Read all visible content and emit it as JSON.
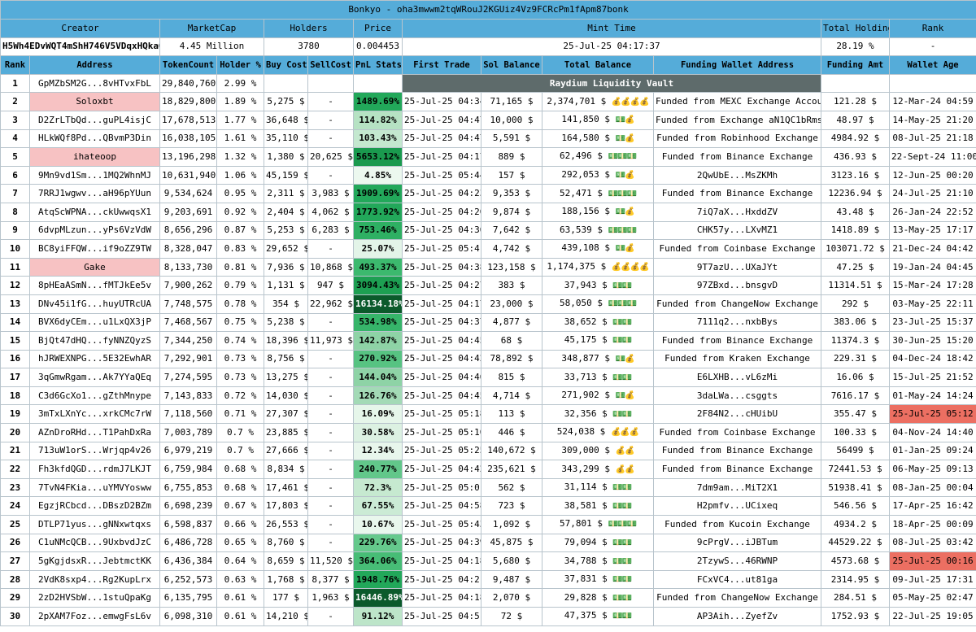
{
  "title": "Bonkyo - oha3mwwm2tqWRouJ2KGUiz4Vz9FCRcPm1fApm87bonk",
  "summary_headers": {
    "creator": "Creator",
    "marketcap": "MarketCap",
    "holders": "Holders",
    "price": "Price",
    "mint_time": "Mint Time",
    "total_holding": "Total Holding",
    "rank": "Rank"
  },
  "summary_values": {
    "creator": "H5Wh4EDvWQT4mShH746V5VDqxHQkaQZyPWfuhy1PRVBg",
    "marketcap": "4.45 Million",
    "holders": "3780",
    "price": "0.004453",
    "mint_time": "25-Jul-25 04:17:37",
    "total_holding": "28.19 %",
    "rank": "-"
  },
  "columns": [
    "Rank",
    "Address",
    "TokenCount",
    "Holder %",
    "Buy Cost",
    "SellCost",
    "PnL Stats",
    "First Trade",
    "Sol Balance",
    "Total Balance",
    "Funding Wallet Address",
    "Funding Amt",
    "Wallet Age"
  ],
  "vault_label": "Raydium Liquidity Vault",
  "rows": [
    {
      "rank": "1",
      "address": "GpMZbSM2G...8vHTvxFbL",
      "tokens": "29,840,760",
      "holder": "2.99 %",
      "vault": true
    },
    {
      "rank": "2",
      "address": "Soloxbt",
      "tokens": "18,829,800",
      "holder": "1.89 %",
      "buy": "5,275 $",
      "sell": "-",
      "pnl": "1489.69%",
      "pnl_color": "#22a85a",
      "first": "25-Jul-25 04:34",
      "sol": "71,165 $",
      "total": "2,374,701 $",
      "icons": "💰💰💰💰",
      "icon_style": "blue",
      "funding": "Funded from MEXC Exchange Account",
      "amt": "121.28 $",
      "age": "12-Mar-24 04:59",
      "highlight": "pink"
    },
    {
      "rank": "3",
      "address": "D2ZrLTbQd...guPL4isjC",
      "tokens": "17,678,513",
      "holder": "1.77 %",
      "buy": "36,648 $",
      "sell": "-",
      "pnl": "114.82%",
      "pnl_color": "#b6e2c3",
      "first": "25-Jul-25 04:47",
      "sol": "10,000 $",
      "total": "141,850 $",
      "icons": "💵💰",
      "icon_style": "grey",
      "funding": "Funded from Exchange aN1QC1bRmsR",
      "amt": "48.97 $",
      "age": "14-May-25 21:20"
    },
    {
      "rank": "4",
      "address": "HLkWQf8Pd...QBvmP3Din",
      "tokens": "16,038,105",
      "holder": "1.61 %",
      "buy": "35,110 $",
      "sell": "-",
      "pnl": "103.43%",
      "pnl_color": "#c4e8cf",
      "first": "25-Jul-25 04:47",
      "sol": "5,591 $",
      "total": "164,580 $",
      "icons": "💵💰",
      "icon_style": "grey",
      "funding": "Funded from Robinhood Exchange",
      "amt": "4984.92 $",
      "age": "08-Jul-25 21:18"
    },
    {
      "rank": "5",
      "address": "ihateoop",
      "tokens": "13,196,298",
      "holder": "1.32 %",
      "buy": "1,380 $",
      "sell": "20,625 $",
      "pnl": "5653.12%",
      "pnl_color": "#1a9a4e",
      "first": "25-Jul-25 04:17",
      "sol": "889 $",
      "total": "62,496 $",
      "icons": "💵💵💵",
      "icon_style": "grey",
      "funding": "Funded from Binance Exchange",
      "amt": "436.93 $",
      "age": "22-Sept-24 11:00",
      "highlight": "pink"
    },
    {
      "rank": "6",
      "address": "9Mn9vd1Sm...1MQ2WhnMJ",
      "tokens": "10,631,940",
      "holder": "1.06 %",
      "buy": "45,159 $",
      "sell": "-",
      "pnl": "4.85%",
      "pnl_color": "#ecf8ef",
      "first": "25-Jul-25 05:44",
      "sol": "157 $",
      "total": "292,053 $",
      "icons": "💵💰",
      "icon_style": "grey",
      "funding": "2QwUbE...MsZKMh",
      "amt": "3123.16 $",
      "age": "12-Jun-25 00:20"
    },
    {
      "rank": "7",
      "address": "7RRJ1wgwv...aH96pYUun",
      "tokens": "9,534,624",
      "holder": "0.95 %",
      "buy": "2,311 $",
      "sell": "3,983 $",
      "pnl": "1909.69%",
      "pnl_color": "#22a85a",
      "first": "25-Jul-25 04:23",
      "sol": "9,353 $",
      "total": "52,471 $",
      "icons": "💵💵💵",
      "icon_style": "grey",
      "funding": "Funded from Binance Exchange",
      "amt": "12236.94 $",
      "age": "24-Jul-25 21:10"
    },
    {
      "rank": "8",
      "address": "AtqScWPNA...ckUwwqsX1",
      "tokens": "9,203,691",
      "holder": "0.92 %",
      "buy": "2,404 $",
      "sell": "4,062 $",
      "pnl": "1773.92%",
      "pnl_color": "#22a85a",
      "first": "25-Jul-25 04:20",
      "sol": "9,874 $",
      "total": "188,156 $",
      "icons": "💵💰",
      "icon_style": "grey",
      "funding": "7iQ7aX...HxddZV",
      "amt": "43.48 $",
      "age": "26-Jan-24 22:52"
    },
    {
      "rank": "9",
      "address": "6dvpMLzun...yPs6VzVdW",
      "tokens": "8,656,296",
      "holder": "0.87 %",
      "buy": "5,253 $",
      "sell": "6,283 $",
      "pnl": "753.46%",
      "pnl_color": "#2eb063",
      "first": "25-Jul-25 04:36",
      "sol": "7,642 $",
      "total": "63,539 $",
      "icons": "💵💵💵",
      "icon_style": "grey",
      "funding": "CHK57y...LXvMZ1",
      "amt": "1418.89 $",
      "age": "13-May-25 17:17"
    },
    {
      "rank": "10",
      "address": "BC8yiFFQW...if9oZZ9TW",
      "tokens": "8,328,047",
      "holder": "0.83 %",
      "buy": "29,652 $",
      "sell": "-",
      "pnl": "25.07%",
      "pnl_color": "#e3f4e8",
      "first": "25-Jul-25 05:41",
      "sol": "4,742 $",
      "total": "439,108 $",
      "icons": "💵💰",
      "icon_style": "grey",
      "funding": "Funded from Coinbase Exchange",
      "amt": "103071.72 $",
      "age": "21-Dec-24 04:42"
    },
    {
      "rank": "11",
      "address": "Gake",
      "tokens": "8,133,730",
      "holder": "0.81 %",
      "buy": "7,936 $",
      "sell": "10,868 $",
      "pnl": "493.37%",
      "pnl_color": "#3cb96e",
      "first": "25-Jul-25 04:38",
      "sol": "123,158 $",
      "total": "1,174,375 $",
      "icons": "💰💰💰💰",
      "icon_style": "blue",
      "funding": "9T7azU...UXaJYt",
      "amt": "47.25 $",
      "age": "19-Jan-24 04:45",
      "highlight": "pink"
    },
    {
      "rank": "12",
      "address": "8pHEaASmN...fMTJkEe5v",
      "tokens": "7,900,262",
      "holder": "0.79 %",
      "buy": "1,131 $",
      "sell": "947 $",
      "pnl": "3094.43%",
      "pnl_color": "#1d9f52",
      "first": "25-Jul-25 04:27",
      "sol": "383 $",
      "total": "37,943 $",
      "icons": "💵💵",
      "icon_style": "grey",
      "funding": "97ZBxd...bnsgvD",
      "amt": "11314.51 $",
      "age": "15-Mar-24 17:28"
    },
    {
      "rank": "13",
      "address": "DNv45i1fG...huyUTRcUA",
      "tokens": "7,748,575",
      "holder": "0.78 %",
      "buy": "354 $",
      "sell": "22,962 $",
      "pnl": "16134.18%",
      "pnl_color": "#0b5a2b",
      "pnl_text": "#ffffff",
      "first": "25-Jul-25 04:17",
      "sol": "23,000 $",
      "total": "58,050 $",
      "icons": "💵💵💵",
      "icon_style": "grey",
      "funding": "Funded from ChangeNow Exchange",
      "amt": "292 $",
      "age": "03-May-25 22:11"
    },
    {
      "rank": "14",
      "address": "BVX6dyCEm...u1LxQX3jP",
      "tokens": "7,468,567",
      "holder": "0.75 %",
      "buy": "5,238 $",
      "sell": "-",
      "pnl": "534.98%",
      "pnl_color": "#36b56a",
      "first": "25-Jul-25 04:37",
      "sol": "4,877 $",
      "total": "38,652 $",
      "icons": "💵💵",
      "icon_style": "grey",
      "funding": "7111q2...nxbBys",
      "amt": "383.06 $",
      "age": "23-Jul-25 15:37"
    },
    {
      "rank": "15",
      "address": "BjQt47dHQ...fyNNZQyzS",
      "tokens": "7,344,250",
      "holder": "0.74 %",
      "buy": "18,396 $",
      "sell": "11,973 $",
      "pnl": "142.87%",
      "pnl_color": "#8ed3a6",
      "first": "25-Jul-25 04:45",
      "sol": "68 $",
      "total": "45,175 $",
      "icons": "💵💵",
      "icon_style": "grey",
      "funding": "Funded from Binance Exchange",
      "amt": "11374.3 $",
      "age": "30-Jun-25 15:20"
    },
    {
      "rank": "16",
      "address": "hJRWEXNPG...5E32EwhAR",
      "tokens": "7,292,901",
      "holder": "0.73 %",
      "buy": "8,756 $",
      "sell": "-",
      "pnl": "270.92%",
      "pnl_color": "#57c382",
      "first": "25-Jul-25 04:42",
      "sol": "78,892 $",
      "total": "348,877 $",
      "icons": "💵💰",
      "icon_style": "grey",
      "funding": "Funded from Kraken Exchange",
      "amt": "229.31 $",
      "age": "04-Dec-24 18:42"
    },
    {
      "rank": "17",
      "address": "3qGmwRgam...Ak7YYaQEq",
      "tokens": "7,274,595",
      "holder": "0.73 %",
      "buy": "13,275 $",
      "sell": "-",
      "pnl": "144.04%",
      "pnl_color": "#8ed3a6",
      "first": "25-Jul-25 04:46",
      "sol": "815 $",
      "total": "33,713 $",
      "icons": "💵💵",
      "icon_style": "grey",
      "funding": "E6LXHB...vL6zMi",
      "amt": "16.06 $",
      "age": "15-Jul-25 21:52"
    },
    {
      "rank": "18",
      "address": "C3d6GcXo1...gZthMnype",
      "tokens": "7,143,833",
      "holder": "0.72 %",
      "buy": "14,030 $",
      "sell": "-",
      "pnl": "126.76%",
      "pnl_color": "#a3dab6",
      "first": "25-Jul-25 04:45",
      "sol": "4,714 $",
      "total": "271,902 $",
      "icons": "💵💰",
      "icon_style": "grey",
      "funding": "3daLWa...csggts",
      "amt": "7616.17 $",
      "age": "01-May-24 14:24"
    },
    {
      "rank": "19",
      "address": "3mTxLXnYc...xrkCMc7rW",
      "tokens": "7,118,560",
      "holder": "0.71 %",
      "buy": "27,307 $",
      "sell": "-",
      "pnl": "16.09%",
      "pnl_color": "#e6f6ea",
      "first": "25-Jul-25 05:18",
      "sol": "113 $",
      "total": "32,356 $",
      "icons": "💵💵",
      "icon_style": "grey",
      "funding": "2F84N2...cHUibU",
      "amt": "355.47 $",
      "age": "25-Jul-25 05:12",
      "age_red": true
    },
    {
      "rank": "20",
      "address": "AZnDroRHd...T1PahDxRa",
      "tokens": "7,003,789",
      "holder": "0.7 %",
      "buy": "23,885 $",
      "sell": "-",
      "pnl": "30.58%",
      "pnl_color": "#dcf1e2",
      "first": "25-Jul-25 05:10",
      "sol": "446 $",
      "total": "524,038 $",
      "icons": "💰💰💰",
      "icon_style": "blue",
      "funding": "Funded from Coinbase Exchange",
      "amt": "100.33 $",
      "age": "04-Nov-24 14:40"
    },
    {
      "rank": "21",
      "address": "713uW1orS...Wrjqp4v26",
      "tokens": "6,979,219",
      "holder": "0.7 %",
      "buy": "27,666 $",
      "sell": "-",
      "pnl": "12.34%",
      "pnl_color": "#e8f6ec",
      "first": "25-Jul-25 05:25",
      "sol": "140,672 $",
      "total": "309,000 $",
      "icons": "💰💰",
      "icon_style": "blue",
      "funding": "Funded from Binance Exchange",
      "amt": "56499 $",
      "age": "01-Jan-25 09:24"
    },
    {
      "rank": "22",
      "address": "Fh3kfdQGD...rdmJ7LKJT",
      "tokens": "6,759,984",
      "holder": "0.68 %",
      "buy": "8,834 $",
      "sell": "-",
      "pnl": "240.77%",
      "pnl_color": "#62c78a",
      "first": "25-Jul-25 04:42",
      "sol": "235,621 $",
      "total": "343,299 $",
      "icons": "💰💰",
      "icon_style": "blue",
      "funding": "Funded from Binance Exchange",
      "amt": "72441.53 $",
      "age": "06-May-25 09:13"
    },
    {
      "rank": "23",
      "address": "7TvN4FKia...uYMVYosww",
      "tokens": "6,755,853",
      "holder": "0.68 %",
      "buy": "17,461 $",
      "sell": "-",
      "pnl": "72.3%",
      "pnl_color": "#c6e9d0",
      "first": "25-Jul-25 05:01",
      "sol": "562 $",
      "total": "31,114 $",
      "icons": "💵💵",
      "icon_style": "grey",
      "funding": "7dm9am...MiT2X1",
      "amt": "51938.41 $",
      "age": "08-Jan-25 00:04"
    },
    {
      "rank": "24",
      "address": "EgzjRCbcd...DBszD2BZm",
      "tokens": "6,698,239",
      "holder": "0.67 %",
      "buy": "17,803 $",
      "sell": "-",
      "pnl": "67.55%",
      "pnl_color": "#cbebd5",
      "first": "25-Jul-25 04:58",
      "sol": "723 $",
      "total": "38,581 $",
      "icons": "💵💵",
      "icon_style": "grey",
      "funding": "H2pmfv...UCixeq",
      "amt": "546.56 $",
      "age": "17-Apr-25 16:42"
    },
    {
      "rank": "25",
      "address": "DTLP71yus...gNNxwtqxs",
      "tokens": "6,598,837",
      "holder": "0.66 %",
      "buy": "26,553 $",
      "sell": "-",
      "pnl": "10.67%",
      "pnl_color": "#e9f7ed",
      "first": "25-Jul-25 05:43",
      "sol": "1,092 $",
      "total": "57,801 $",
      "icons": "💵💵💵",
      "icon_style": "grey",
      "funding": "Funded from Kucoin Exchange",
      "amt": "4934.2 $",
      "age": "18-Apr-25 00:09"
    },
    {
      "rank": "26",
      "address": "C1uNMcQCB...9UxbvdJzC",
      "tokens": "6,486,728",
      "holder": "0.65 %",
      "buy": "8,760 $",
      "sell": "-",
      "pnl": "229.76%",
      "pnl_color": "#65c98c",
      "first": "25-Jul-25 04:39",
      "sol": "45,875 $",
      "total": "79,094 $",
      "icons": "💵💵",
      "icon_style": "grey",
      "funding": "9cPrgV...iJBTum",
      "amt": "44529.22 $",
      "age": "08-Jul-25 03:42"
    },
    {
      "rank": "27",
      "address": "5gKgjdsxR...JebtmctKK",
      "tokens": "6,436,384",
      "holder": "0.64 %",
      "buy": "8,659 $",
      "sell": "11,520 $",
      "pnl": "364.06%",
      "pnl_color": "#47bd76",
      "first": "25-Jul-25 04:18",
      "sol": "5,680 $",
      "total": "34,788 $",
      "icons": "💵💵",
      "icon_style": "grey",
      "funding": "2TzywS...46RWNP",
      "amt": "4573.68 $",
      "age": "25-Jul-25 00:16",
      "age_red": true
    },
    {
      "rank": "28",
      "address": "2VdK8sxp4...Rg2KupLrx",
      "tokens": "6,252,573",
      "holder": "0.63 %",
      "buy": "1,768 $",
      "sell": "8,377 $",
      "pnl": "1948.76%",
      "pnl_color": "#22a85a",
      "first": "25-Jul-25 04:21",
      "sol": "9,487 $",
      "total": "37,831 $",
      "icons": "💵💵",
      "icon_style": "grey",
      "funding": "FCxVC4...ut81ga",
      "amt": "2314.95 $",
      "age": "09-Jul-25 17:31"
    },
    {
      "rank": "29",
      "address": "2zD2HVSbW...1stuQpaKg",
      "tokens": "6,135,795",
      "holder": "0.61 %",
      "buy": "177 $",
      "sell": "1,963 $",
      "pnl": "16446.89%",
      "pnl_color": "#0b5a2b",
      "pnl_text": "#ffffff",
      "first": "25-Jul-25 04:18",
      "sol": "2,070 $",
      "total": "29,828 $",
      "icons": "💵💵",
      "icon_style": "grey",
      "funding": "Funded from ChangeNow Exchange",
      "amt": "284.51 $",
      "age": "05-May-25 02:47"
    },
    {
      "rank": "30",
      "address": "2pXAM7Foz...emwgFsL6v",
      "tokens": "6,098,310",
      "holder": "0.61 %",
      "buy": "14,210 $",
      "sell": "-",
      "pnl": "91.12%",
      "pnl_color": "#bde5c9",
      "first": "25-Jul-25 04:51",
      "sol": "72 $",
      "total": "47,375 $",
      "icons": "💵💵",
      "icon_style": "grey",
      "funding": "AP3Aih...ZyefZv",
      "amt": "1752.93 $",
      "age": "22-Jul-25 19:05"
    }
  ]
}
